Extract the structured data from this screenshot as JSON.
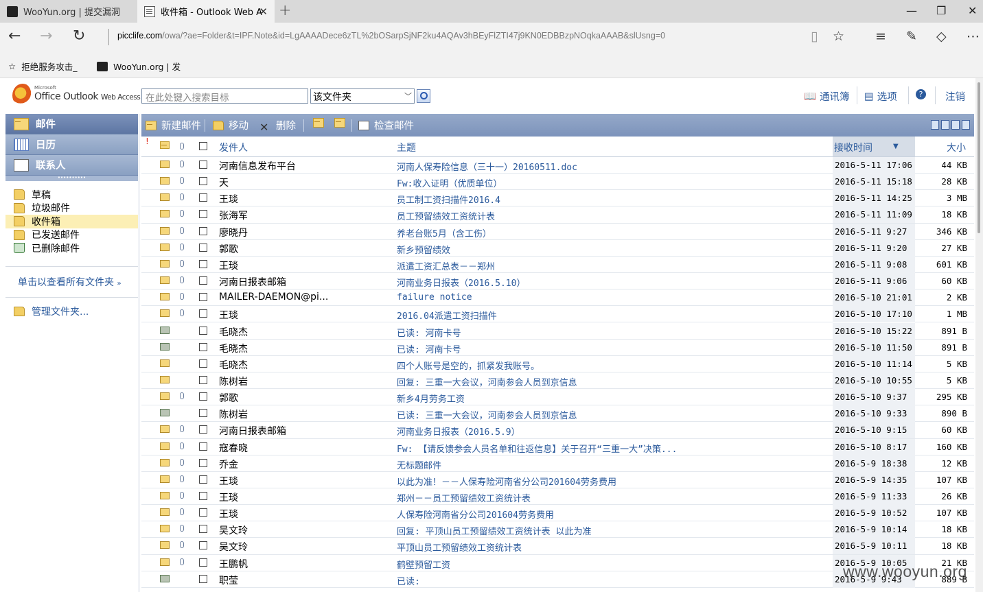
{
  "browser": {
    "tabs": [
      {
        "label": "WooYun.org | 提交漏洞",
        "favicon": "wooyun-icon"
      },
      {
        "label": "收件箱 - Outlook Web A",
        "favicon": "page-icon"
      }
    ],
    "url_host": "picclife.com",
    "url_path": "/owa/?ae=Folder&t=IPF.Note&id=LgAAAADece6zTL%2bOSarpSjNF2ku4AQAv3hBEyFlZTI47j9KN0EDBBzpNOqkaAAAB&slUsng=0",
    "favorites": [
      {
        "label": "拒绝服务攻击_",
        "icon": "star-icon"
      },
      {
        "label": "WooYun.org | 发",
        "icon": "wooyun-icon"
      }
    ]
  },
  "owa": {
    "logo_small": "Microsoft",
    "logo_main": "Office Outlook",
    "logo_sub": "Web Access",
    "search_placeholder": "在此处键入搜索目标",
    "search_scope": "该文件夹",
    "links": {
      "addressbook": "通讯簿",
      "options": "选项",
      "logout": "注销"
    },
    "nav": {
      "mail": "邮件",
      "calendar": "日历",
      "contacts": "联系人"
    },
    "folders": [
      "草稿",
      "垃圾邮件",
      "收件箱",
      "已发送邮件",
      "已删除邮件"
    ],
    "selected_folder": "收件箱",
    "all_folders": "单击以查看所有文件夹",
    "manage_folders": "管理文件夹..."
  },
  "toolbar": {
    "new_mail": "新建邮件",
    "move": "移动",
    "delete": "删除",
    "check_mail": "检查邮件"
  },
  "list": {
    "columns": {
      "sender": "发件人",
      "subject": "主题",
      "received": "接收时间",
      "size": "大小"
    },
    "rows": [
      {
        "sender": "河南信息发布平台",
        "subject": "河南人保寿险信息（三十一）20160511.doc",
        "date": "2016-5-11 17:06",
        "size": "44 KB",
        "attach": true,
        "type": "unread"
      },
      {
        "sender": "天",
        "subject": "Fw:收入证明（优质单位）",
        "date": "2016-5-11 15:18",
        "size": "28 KB",
        "attach": true,
        "type": "unread"
      },
      {
        "sender": "王琰",
        "subject": "员工制工资扫描件2016.4",
        "date": "2016-5-11 14:25",
        "size": "3 MB",
        "attach": true,
        "type": "unread"
      },
      {
        "sender": "张海军",
        "subject": "员工预留绩效工资统计表",
        "date": "2016-5-11 11:09",
        "size": "18 KB",
        "attach": true,
        "type": "unread"
      },
      {
        "sender": "廖晓丹",
        "subject": "养老台账5月（含工伤）",
        "date": "2016-5-11 9:27",
        "size": "346 KB",
        "attach": true,
        "type": "unread"
      },
      {
        "sender": "郭歌",
        "subject": "新乡预留绩效",
        "date": "2016-5-11 9:20",
        "size": "27 KB",
        "attach": true,
        "type": "unread"
      },
      {
        "sender": "王琰",
        "subject": "派遣工资汇总表－－郑州",
        "date": "2016-5-11 9:08",
        "size": "601 KB",
        "attach": true,
        "type": "unread"
      },
      {
        "sender": "河南日报表邮箱",
        "subject": "河南业务日报表（2016.5.10）",
        "date": "2016-5-11 9:06",
        "size": "60 KB",
        "attach": true,
        "type": "unread"
      },
      {
        "sender": "MAILER-DAEMON@pi...",
        "subject": "failure notice",
        "date": "2016-5-10 21:01",
        "size": "2 KB",
        "attach": true,
        "type": "unread"
      },
      {
        "sender": "王琰",
        "subject": "2016.04派遣工资扫描件",
        "date": "2016-5-10 17:10",
        "size": "1 MB",
        "attach": true,
        "type": "unread"
      },
      {
        "sender": "毛晓杰",
        "subject": "已读: 河南卡号",
        "date": "2016-5-10 15:22",
        "size": "891 B",
        "attach": false,
        "type": "receipt"
      },
      {
        "sender": "毛晓杰",
        "subject": "已读: 河南卡号",
        "date": "2016-5-10 11:50",
        "size": "891 B",
        "attach": false,
        "type": "receipt"
      },
      {
        "sender": "毛晓杰",
        "subject": "四个人账号是空的，抓紧发我账号。",
        "date": "2016-5-10 11:14",
        "size": "5 KB",
        "attach": false,
        "type": "unread"
      },
      {
        "sender": "陈树岩",
        "subject": "回复: 三重一大会议，河南参会人员到京信息",
        "date": "2016-5-10 10:55",
        "size": "5 KB",
        "attach": false,
        "type": "unread"
      },
      {
        "sender": "郭歌",
        "subject": "新乡4月劳务工资",
        "date": "2016-5-10 9:37",
        "size": "295 KB",
        "attach": true,
        "type": "unread"
      },
      {
        "sender": "陈树岩",
        "subject": "已读: 三重一大会议，河南参会人员到京信息",
        "date": "2016-5-10 9:33",
        "size": "890 B",
        "attach": false,
        "type": "receipt"
      },
      {
        "sender": "河南日报表邮箱",
        "subject": "河南业务日报表（2016.5.9）",
        "date": "2016-5-10 9:15",
        "size": "60 KB",
        "attach": true,
        "type": "unread"
      },
      {
        "sender": "寇春晓",
        "subject": "Fw: 【请反馈参会人员名单和往返信息】关于召开“三重一大”决策...",
        "date": "2016-5-10 8:17",
        "size": "160 KB",
        "attach": true,
        "type": "unread"
      },
      {
        "sender": "乔金",
        "subject": "无标题邮件",
        "date": "2016-5-9 18:38",
        "size": "12 KB",
        "attach": true,
        "type": "unread"
      },
      {
        "sender": "王琰",
        "subject": "以此为准！－－人保寿险河南省分公司201604劳务费用",
        "date": "2016-5-9 14:35",
        "size": "107 KB",
        "attach": true,
        "type": "unread"
      },
      {
        "sender": "王琰",
        "subject": "郑州－－员工预留绩效工资统计表",
        "date": "2016-5-9 11:33",
        "size": "26 KB",
        "attach": true,
        "type": "unread"
      },
      {
        "sender": "王琰",
        "subject": "人保寿险河南省分公司201604劳务费用",
        "date": "2016-5-9 10:52",
        "size": "107 KB",
        "attach": true,
        "type": "unread"
      },
      {
        "sender": "吴文玲",
        "subject": "回复: 平顶山员工预留绩效工资统计表 以此为准",
        "date": "2016-5-9 10:14",
        "size": "18 KB",
        "attach": true,
        "type": "unread"
      },
      {
        "sender": "吴文玲",
        "subject": "平顶山员工预留绩效工资统计表",
        "date": "2016-5-9 10:11",
        "size": "18 KB",
        "attach": true,
        "type": "unread"
      },
      {
        "sender": "王鹏帆",
        "subject": "鹤壁预留工资",
        "date": "2016-5-9 10:05",
        "size": "21 KB",
        "attach": true,
        "type": "unread"
      },
      {
        "sender": "职莹",
        "subject": "已读:",
        "date": "2016-5-9 9:43",
        "size": "889 B",
        "attach": false,
        "type": "receipt"
      }
    ]
  },
  "watermark": "www.wooyun.org",
  "colors": {
    "link": "#2b5a9c",
    "toolbar": "#8aa0c2",
    "selected_folder": "#fcefb5"
  }
}
